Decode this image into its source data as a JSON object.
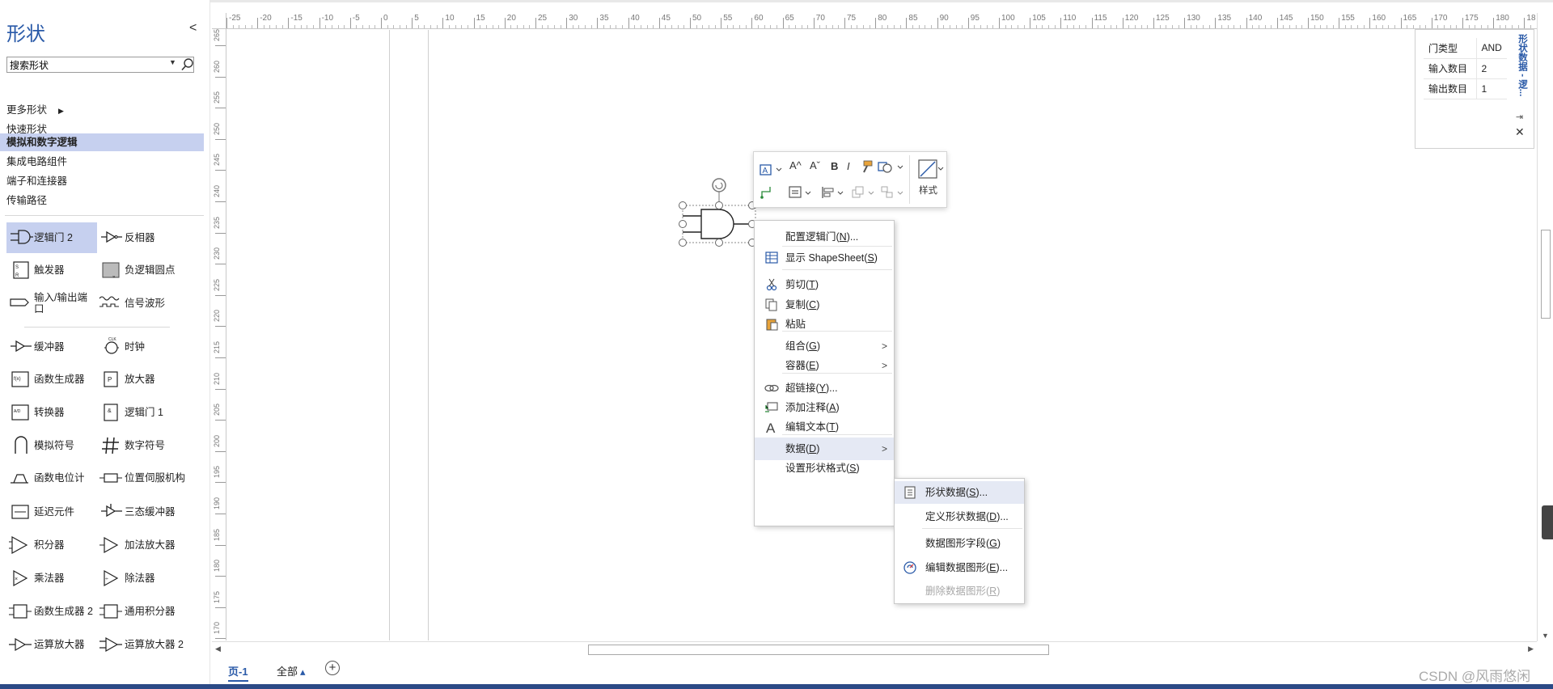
{
  "panel": {
    "title": "形状",
    "collapse": "<",
    "search_placeholder": "搜索形状",
    "categories": [
      {
        "label": "更多形状",
        "arrow": "▶"
      },
      {
        "label": "快速形状"
      },
      {
        "label": "模拟和数字逻辑",
        "selected": true
      },
      {
        "label": "集成电路组件"
      },
      {
        "label": "端子和连接器"
      },
      {
        "label": "传输路径"
      }
    ],
    "stencils": [
      {
        "label": "逻辑门 2",
        "icon": "and-gate-icon",
        "selected": true
      },
      {
        "label": "反相器",
        "icon": "inverter-icon"
      },
      {
        "label": "触发器",
        "icon": "flip-flop-icon"
      },
      {
        "label": "负逻辑圆点",
        "icon": "negative-logic-dot-icon"
      },
      {
        "label": "输入/输出端口",
        "icon": "io-port-icon"
      },
      {
        "label": "信号波形",
        "icon": "signal-waveform-icon"
      },
      {
        "label": "缓冲器",
        "icon": "buffer-icon"
      },
      {
        "label": "时钟",
        "icon": "clock-icon"
      },
      {
        "label": "函数生成器",
        "icon": "function-generator-icon"
      },
      {
        "label": "放大器",
        "icon": "amplifier-icon"
      },
      {
        "label": "转换器",
        "icon": "converter-icon"
      },
      {
        "label": "逻辑门 1",
        "icon": "logic-gate-1-icon"
      },
      {
        "label": "模拟符号",
        "icon": "analog-symbol-icon"
      },
      {
        "label": "数字符号",
        "icon": "digital-symbol-icon"
      },
      {
        "label": "函数电位计",
        "icon": "function-potentiometer-icon"
      },
      {
        "label": "位置伺服机构",
        "icon": "position-servo-icon"
      },
      {
        "label": "延迟元件",
        "icon": "delay-element-icon"
      },
      {
        "label": "三态缓冲器",
        "icon": "tristate-buffer-icon"
      },
      {
        "label": "积分器",
        "icon": "integrator-icon"
      },
      {
        "label": "加法放大器",
        "icon": "summing-amplifier-icon"
      },
      {
        "label": "乘法器",
        "icon": "multiplier-icon"
      },
      {
        "label": "除法器",
        "icon": "divider-icon"
      },
      {
        "label": "函数生成器 2",
        "icon": "function-generator-2-icon"
      },
      {
        "label": "通用积分器",
        "icon": "general-integrator-icon"
      },
      {
        "label": "运算放大器",
        "icon": "op-amp-icon"
      },
      {
        "label": "运算放大器 2",
        "icon": "op-amp-2-icon"
      }
    ]
  },
  "rulers": {
    "horizontal": [
      "-25",
      "-20",
      "-15",
      "-10",
      "-5",
      "0",
      "5",
      "10",
      "15",
      "20",
      "25",
      "30",
      "35",
      "40",
      "45",
      "50",
      "55",
      "60",
      "65",
      "70",
      "75",
      "80",
      "85",
      "90",
      "95",
      "100",
      "105",
      "110",
      "115",
      "120",
      "125",
      "130",
      "135",
      "140",
      "145",
      "150",
      "155",
      "160",
      "165",
      "170",
      "175",
      "180",
      "18"
    ],
    "vertical": [
      "265",
      "260",
      "255",
      "250",
      "245",
      "240",
      "235",
      "230",
      "225",
      "220",
      "215",
      "210",
      "205",
      "200",
      "195",
      "190",
      "185",
      "180",
      "175",
      "170"
    ]
  },
  "shape_data": {
    "title": "形状数据 - 逻...",
    "rows": [
      {
        "key": "门类型",
        "value": "AND"
      },
      {
        "key": "输入数目",
        "value": "2"
      },
      {
        "key": "输出数目",
        "value": "1"
      }
    ],
    "pin": "⇥",
    "close": "✕"
  },
  "toolbar": {
    "style_label": "样式",
    "font_grow": "A^",
    "font_shrink": "Aˇ",
    "bold": "B",
    "italic": "I"
  },
  "context_menu": {
    "items": [
      {
        "text": "配置逻辑门(",
        "key": "N",
        "tail": ")..."
      },
      {
        "text": "显示 ShapeSheet(",
        "key": "S",
        "tail": ")",
        "icon": "shapesheet-icon"
      },
      {
        "text": "剪切(",
        "key": "T",
        "tail": ")",
        "icon": "cut-icon"
      },
      {
        "text": "复制(",
        "key": "C",
        "tail": ")",
        "icon": "copy-icon"
      },
      {
        "text": "粘贴",
        "key": "",
        "tail": "",
        "icon": "paste-icon"
      },
      {
        "text": "组合(",
        "key": "G",
        "tail": ")",
        "arrow": ">"
      },
      {
        "text": "容器(",
        "key": "E",
        "tail": ")",
        "arrow": ">"
      },
      {
        "text": "超链接(",
        "key": "Y",
        "tail": ")...",
        "icon": "hyperlink-icon"
      },
      {
        "text": "添加注释(",
        "key": "A",
        "tail": ")",
        "icon": "comment-icon"
      },
      {
        "text": "编辑文本(",
        "key": "T",
        "tail": ")",
        "icon": "edit-text-icon"
      },
      {
        "text": "数据(",
        "key": "D",
        "tail": ")",
        "arrow": ">"
      },
      {
        "text": "设置形状格式(",
        "key": "S",
        "tail": ")"
      }
    ]
  },
  "sub_menu": {
    "items": [
      {
        "text": "形状数据(",
        "key": "S",
        "tail": ")...",
        "icon": "shape-data-icon"
      },
      {
        "text": "定义形状数据(",
        "key": "D",
        "tail": ")..."
      },
      {
        "text": "数据图形字段(",
        "key": "G",
        "tail": ")"
      },
      {
        "text": "编辑数据图形(",
        "key": "E",
        "tail": ")...",
        "icon": "edit-data-graphic-icon"
      },
      {
        "text": "删除数据图形(",
        "key": "R",
        "tail": ")",
        "disabled": true
      }
    ]
  },
  "page_tabs": {
    "page1": "页-1",
    "all": "全部",
    "all_arrow": "▴",
    "add": "+"
  },
  "watermark": "CSDN @风雨悠闲",
  "colors": {
    "accent": "#2a5aa8",
    "selected_bg": "#c6d0ef",
    "menu_hover": "#e5e9f4"
  }
}
